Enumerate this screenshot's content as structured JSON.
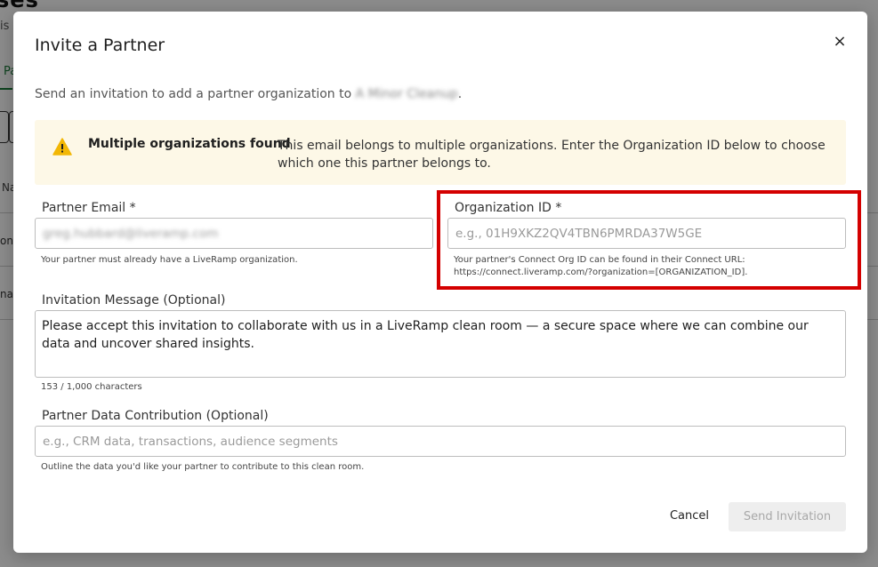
{
  "background": {
    "title": "ses",
    "subtitle": "is",
    "tab_label": "Pa",
    "column_label": "Na",
    "row_texts": [
      "on",
      "na"
    ]
  },
  "modal": {
    "title": "Invite a Partner",
    "close_icon": "×",
    "intro_prefix": "Send an invitation to add a partner organization to ",
    "intro_org_name": "A Minor Cleanup",
    "intro_suffix": ".",
    "warning": {
      "icon": "warning-triangle-icon",
      "heading": "Multiple organizations found",
      "body": "This email belongs to multiple organizations. Enter the Organization ID below to choose which one this partner belongs to."
    },
    "partner_email": {
      "label": "Partner Email *",
      "value": "greg.hubbard@liveramp.com",
      "hint": "Your partner must already have a LiveRamp organization."
    },
    "organization_id": {
      "label": "Organization ID *",
      "placeholder": "e.g., 01H9XKZ2QV4TBN6PMRDA37W5GE",
      "hint_line1": "Your partner's Connect Org ID can be found in their Connect URL:",
      "hint_line2": "https://connect.liveramp.com/?organization=[ORGANIZATION_ID]."
    },
    "invitation_message": {
      "label": "Invitation Message (Optional)",
      "value": "Please accept this invitation to collaborate with us in a LiveRamp clean room — a secure space where we can combine our data and uncover shared insights.",
      "counter": "153 / 1,000 characters"
    },
    "data_contribution": {
      "label": "Partner Data Contribution (Optional)",
      "placeholder": "e.g., CRM data, transactions, audience segments",
      "hint": "Outline the data you'd like your partner to contribute to this clean room."
    },
    "buttons": {
      "cancel": "Cancel",
      "send": "Send Invitation"
    }
  },
  "colors": {
    "highlight": "#d40000",
    "warning_bg": "#fdf8e7",
    "warning_icon": "#f2b705",
    "accent": "#1a7a3a"
  }
}
